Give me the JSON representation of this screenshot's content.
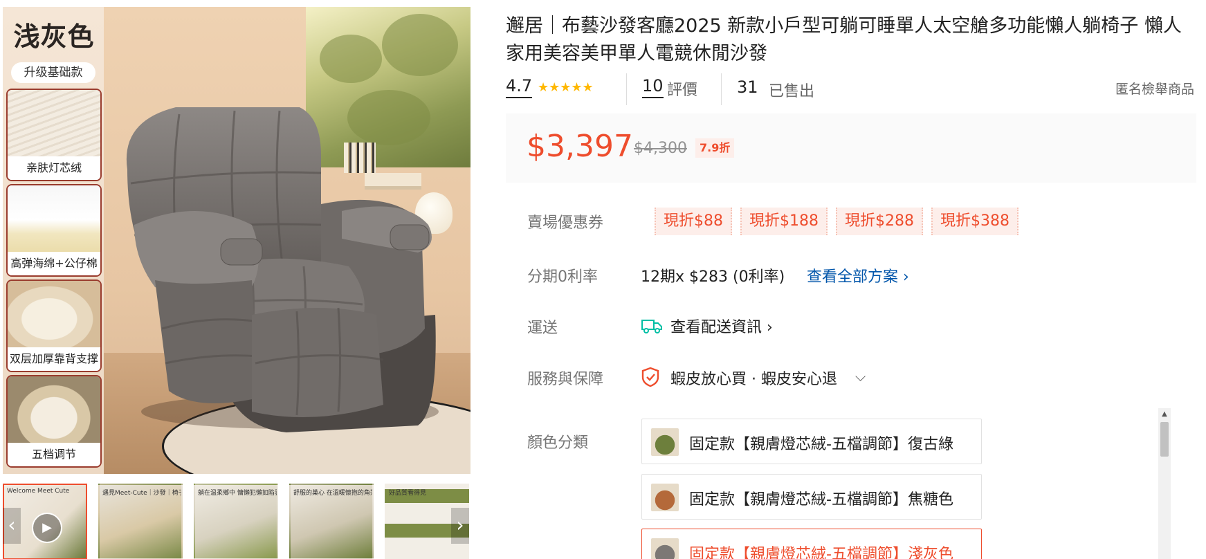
{
  "gallery": {
    "panel_title": "浅灰色",
    "panel_badge": "升级基础款",
    "features": [
      {
        "label": "亲肤灯芯绒"
      },
      {
        "label": "高弹海绵+公仔棉"
      },
      {
        "label": "双层加厚靠背支撑"
      },
      {
        "label": "五档调节"
      }
    ],
    "thumb_texts": [
      "Welcome Meet Cute",
      "遇見Meet-Cute｜沙發｜椅子｜",
      "躺在溫柔鄉中 慵懶犯懶如陷雲端",
      "舒服的巢心 在溫暖懷抱的角落",
      "好品質看得見"
    ],
    "play_icon": "play-icon",
    "prev_icon": "chevron-left-icon",
    "next_icon": "chevron-right-icon"
  },
  "product": {
    "title": "邂居｜布藝沙發客廳2025 新款小戶型可躺可睡單人太空艙多功能懶人躺椅子 懶人家用美容美甲單人電競休閒沙發",
    "rating": "4.7",
    "stars": "★★★★★",
    "reviews_count": "10",
    "reviews_label": "評價",
    "sold_count": "31",
    "sold_label": "已售出",
    "report_label": "匿名檢舉商品"
  },
  "price": {
    "current": "$3,397",
    "original": "$4,300",
    "discount": "7.9折"
  },
  "coupons": {
    "label": "賣場優惠券",
    "items": [
      "現折$88",
      "現折$188",
      "現折$288",
      "現折$388"
    ]
  },
  "installment": {
    "label": "分期0利率",
    "text": "12期x $283 (0利率)",
    "link": "查看全部方案 ›"
  },
  "shipping": {
    "label": "運送",
    "text": "查看配送資訊 ›",
    "icon": "truck-icon"
  },
  "service": {
    "label": "服務與保障",
    "text": "蝦皮放心買 · 蝦皮安心退",
    "chevron": "⌵",
    "icon": "shield-check-icon"
  },
  "variations": {
    "label": "顏色分類",
    "options": [
      {
        "text": "固定款【親膚燈芯絨-五檔調節】復古綠",
        "selected": false
      },
      {
        "text": "固定款【親膚燈芯絨-五檔調節】焦糖色",
        "selected": false
      },
      {
        "text": "固定款【親膚燈芯絨-五檔調節】淺灰色",
        "selected": true
      }
    ]
  },
  "colors": {
    "accent": "#ee4d2d",
    "link": "#0055aa",
    "star": "#ffb800"
  }
}
